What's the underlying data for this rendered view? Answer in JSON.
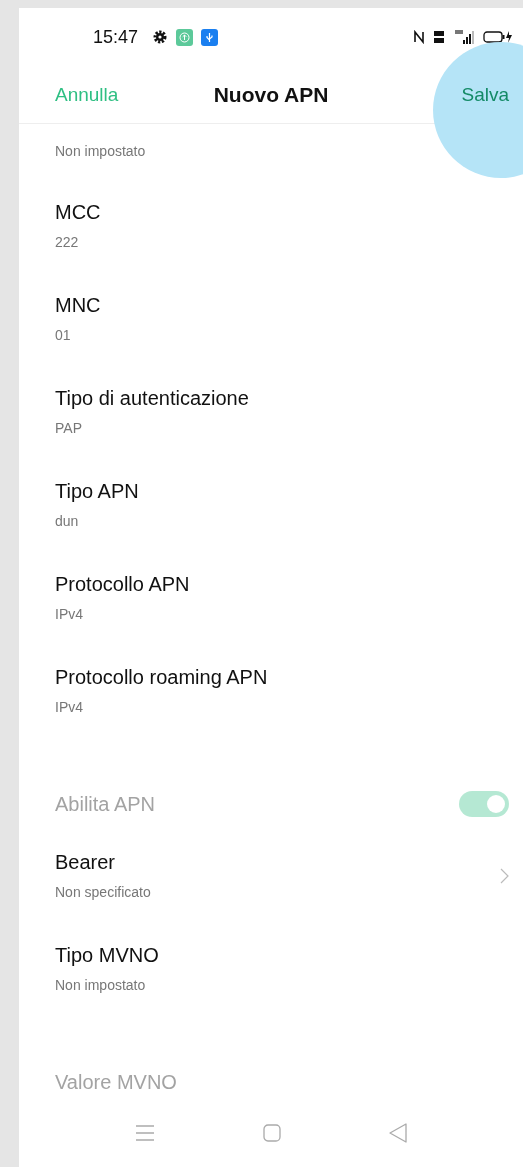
{
  "status_bar": {
    "time": "15:47"
  },
  "header": {
    "cancel": "Annulla",
    "title": "Nuovo APN",
    "save": "Salva"
  },
  "items": [
    {
      "kind": "value",
      "value": "Non impostato",
      "disabled": false
    },
    {
      "kind": "value",
      "title": "MCC",
      "value": "222",
      "disabled": false
    },
    {
      "kind": "value",
      "title": "MNC",
      "value": "01",
      "disabled": false
    },
    {
      "kind": "value",
      "title": "Tipo di autenticazione",
      "value": "PAP",
      "disabled": false
    },
    {
      "kind": "value",
      "title": "Tipo APN",
      "value": "dun",
      "disabled": false
    },
    {
      "kind": "value",
      "title": "Protocollo APN",
      "value": "IPv4",
      "disabled": false
    },
    {
      "kind": "value",
      "title": "Protocollo roaming APN",
      "value": "IPv4",
      "disabled": false
    },
    {
      "kind": "toggle",
      "title": "Abilita APN",
      "on": true,
      "disabled": true
    },
    {
      "kind": "link",
      "title": "Bearer",
      "value": "Non specificato",
      "disabled": false
    },
    {
      "kind": "value",
      "title": "Tipo MVNO",
      "value": "Non impostato",
      "disabled": false
    },
    {
      "kind": "value",
      "title": "Valore MVNO",
      "disabled": true
    }
  ]
}
